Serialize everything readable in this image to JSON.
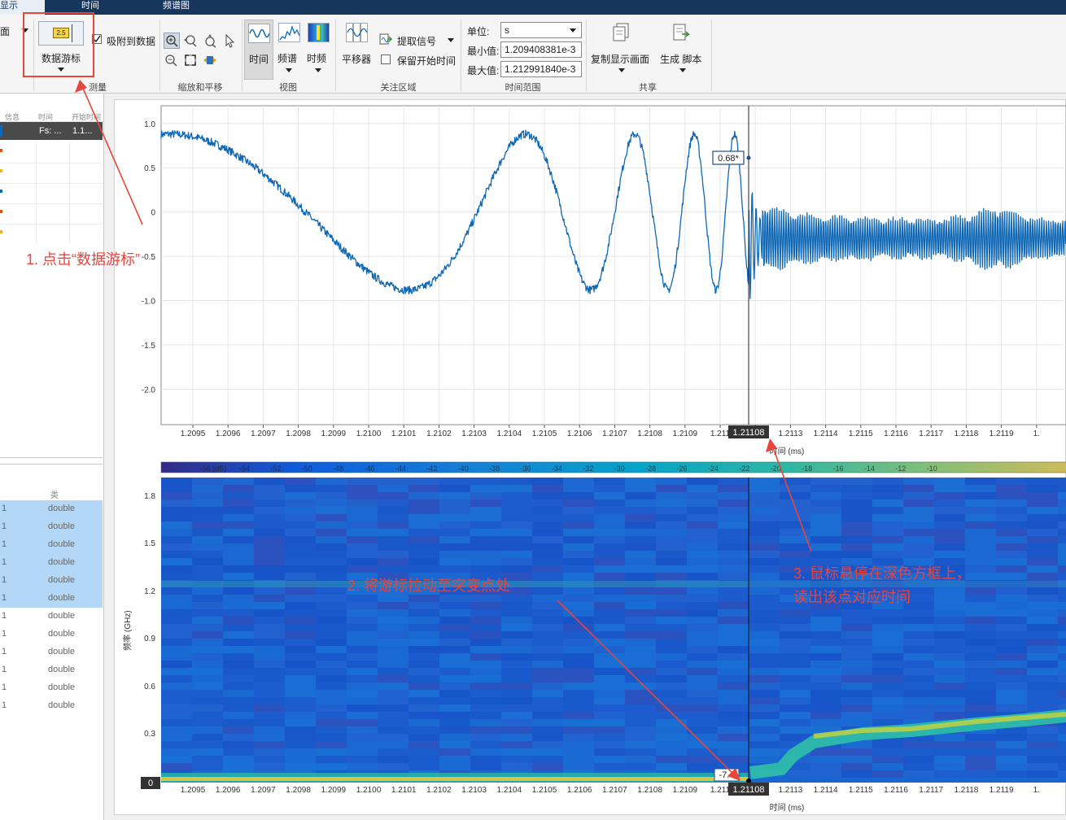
{
  "tabs": [
    {
      "label": "显示"
    },
    {
      "label": "时间"
    },
    {
      "label": "频谱图"
    }
  ],
  "ribbon": {
    "partial_label": "面",
    "cursor_btn": {
      "icon_text": "2.5",
      "label": "数据游标"
    },
    "snap_label": "吸附到数据",
    "groups": {
      "measure": "测量",
      "zoom": "缩放和平移",
      "view": "视图",
      "roi": "关注区域",
      "range": "时间范围",
      "share": "共享"
    },
    "view_buttons": [
      "时间",
      "频谱",
      "时频"
    ],
    "shifter_label": "平移器",
    "extract_label": "提取信号",
    "keep_start_label": "保留开始时间",
    "units_label": "单位:",
    "units_value": "s",
    "min_label": "最小值:",
    "min_value": "1.209408381e-3",
    "max_label": "最大值:",
    "max_value": "1.212991840e-3",
    "copy_label": "复制显示画面",
    "gen_label": "生成 脚本"
  },
  "left_top": {
    "headers": [
      "信息",
      "时间",
      "开始时间"
    ],
    "row_cells": [
      "Fs: ...",
      "1.1..."
    ]
  },
  "left_bottom": {
    "header": "类",
    "rows": [
      "double",
      "double",
      "double",
      "double",
      "double",
      "double",
      "double",
      "double",
      "double",
      "double",
      "double",
      "double"
    ],
    "index": "1"
  },
  "colors": {
    "signal": "#1068b5",
    "accent": "#e8453c",
    "tabbar": "#17365d"
  },
  "time_plot": {
    "ylim": [
      -2.4,
      1.2
    ],
    "yticks": [
      "1.0",
      "0.5",
      "0",
      "-0.5",
      "-1.0",
      "-1.5",
      "-2.0"
    ],
    "xticks": [
      "1.2095",
      "1.2096",
      "1.2097",
      "1.2098",
      "1.2099",
      "1.2100",
      "1.2101",
      "1.2102",
      "1.2103",
      "1.2104",
      "1.2105",
      "1.2106",
      "1.2107",
      "1.2108",
      "1.2109",
      "1.211",
      "1.2112",
      "1.2113",
      "1.2114",
      "1.2115",
      "1.2116",
      "1.2117",
      "1.2118",
      "1.2119",
      "1."
    ],
    "xlabel": "时间 (ms)",
    "cursor_x": "1.21108",
    "cursor_y": "0.68*"
  },
  "colorbar": {
    "ticks": [
      "-56 (dB)",
      "-54",
      "-52",
      "-50",
      "-48",
      "-46",
      "-44",
      "-42",
      "-40",
      "-38",
      "-36",
      "-34",
      "-32",
      "-30",
      "-28",
      "-26",
      "-24",
      "-22",
      "-20",
      "-18",
      "-16",
      "-14",
      "-12",
      "-10"
    ]
  },
  "spec_plot": {
    "ylabel": "频率 (GHz)",
    "yticks": [
      "1.8",
      "1.5",
      "1.2",
      "0.9",
      "0.6",
      "0.3",
      "0"
    ],
    "xticks": [
      "1.2095",
      "1.2096",
      "1.2097",
      "1.2098",
      "1.2099",
      "1.2100",
      "1.2101",
      "1.2102",
      "1.2103",
      "1.2104",
      "1.2105",
      "1.2106",
      "1.2107",
      "1.2108",
      "1.2109",
      "1.211",
      "1.2112",
      "1.2113",
      "1.2114",
      "1.2115",
      "1.2116",
      "1.2117",
      "1.2118",
      "1.2119",
      "1."
    ],
    "xlabel": "时间 (ms)",
    "cursor_x": "1.21108",
    "cursor_val": "-7.4"
  },
  "annotations": {
    "step1": "1. 点击“数据游标”",
    "step2": "2. 将游标拉动至突变点处",
    "step3_line1": "3. 鼠标悬停在深色方框上，",
    "step3_line2": "读出该点对应时间"
  }
}
